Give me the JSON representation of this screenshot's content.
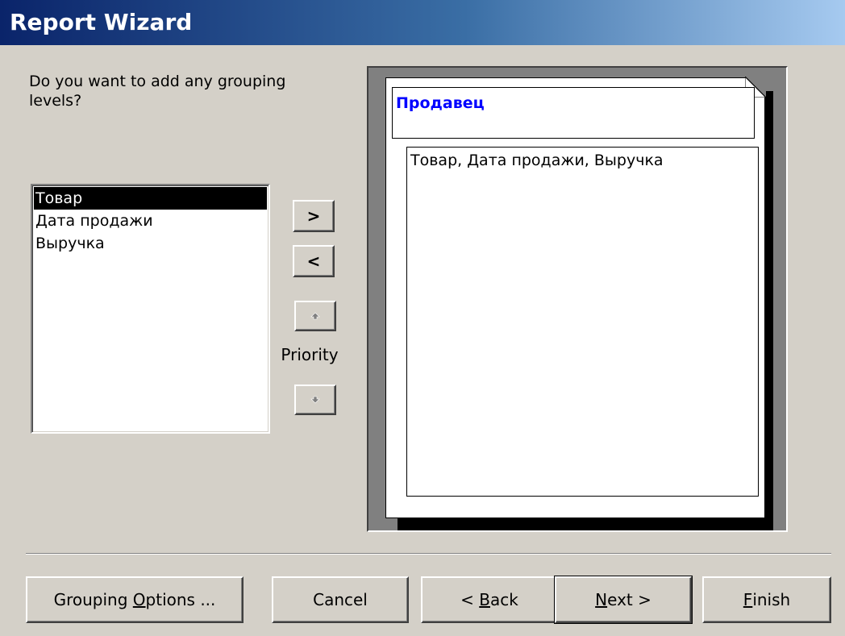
{
  "window": {
    "title": "Report Wizard"
  },
  "prompt": "Do you want to add any grouping levels?",
  "fields": [
    "Товар",
    "Дата продажи",
    "Выручка"
  ],
  "selected_field": "Товар",
  "move_buttons": {
    "add": ">",
    "remove": "<"
  },
  "priority": {
    "label": "Priority",
    "up_icon": "up-arrow-icon",
    "down_icon": "down-arrow-icon"
  },
  "preview": {
    "group_header": "Продавец",
    "detail_fields": "Товар, Дата продажи, Выручка"
  },
  "buttons": {
    "grouping_options_pre": "Grouping ",
    "grouping_options_accel": "O",
    "grouping_options_post": "ptions ...",
    "cancel": "Cancel",
    "back_pre": "< ",
    "back_accel": "B",
    "back_post": "ack",
    "next_accel": "N",
    "next_post": "ext >",
    "finish_accel": "F",
    "finish_post": "inish"
  }
}
